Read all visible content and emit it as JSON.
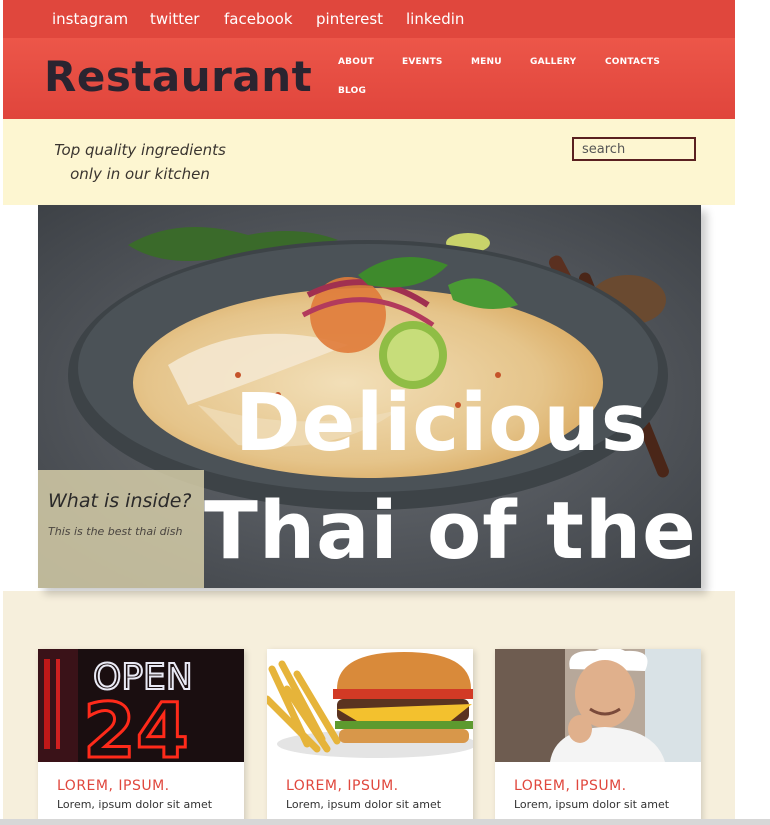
{
  "social": [
    "instagram",
    "twitter",
    "facebook",
    "pinterest",
    "linkedin"
  ],
  "brand": "Restaurant",
  "nav": [
    "ABOUT",
    "EVENTS",
    "MENU",
    "GALLERY",
    "CONTACTS",
    "BLOG"
  ],
  "tagline": {
    "line1": "Top quality ingredients",
    "line2": "only in our kitchen"
  },
  "search": {
    "placeholder": "search"
  },
  "hero": {
    "headline_line1": "Delicious",
    "headline_line2": "Thai of the",
    "caption_title": "What is inside?",
    "caption_text": "This is the best thai dish"
  },
  "cards": [
    {
      "title": "LOREM, IPSUM.",
      "text": "Lorem, ipsum dolor sit amet"
    },
    {
      "title": "LOREM, IPSUM.",
      "text": "Lorem, ipsum dolor sit amet"
    },
    {
      "title": "LOREM, IPSUM.",
      "text": "Lorem, ipsum dolor sit amet"
    }
  ],
  "colors": {
    "brand_red": "#e0473d",
    "cream": "#fdf6d1",
    "beige": "#f6efdc",
    "logo_text": "#2a2430"
  }
}
